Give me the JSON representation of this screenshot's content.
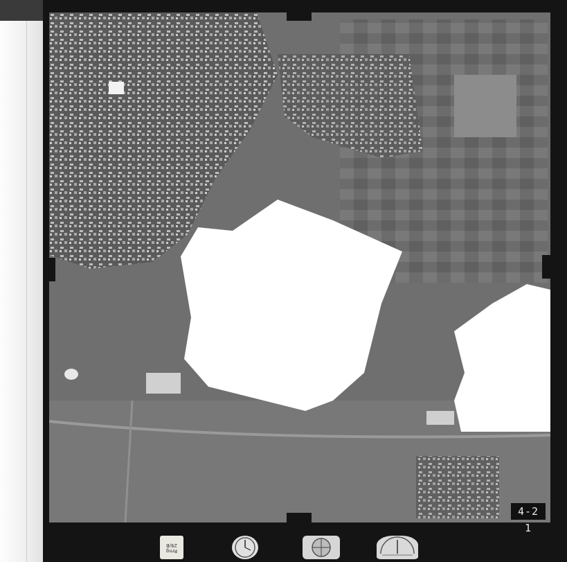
{
  "photo": {
    "frame_number": "4-2 1",
    "description_free": true
  },
  "instruments": {
    "data_card_text": "Rmg 29/B"
  },
  "colors": {
    "frame": "#141414",
    "terrain": "#707070",
    "masked_area": "#ffffff",
    "margin": "#f4f4f4"
  }
}
